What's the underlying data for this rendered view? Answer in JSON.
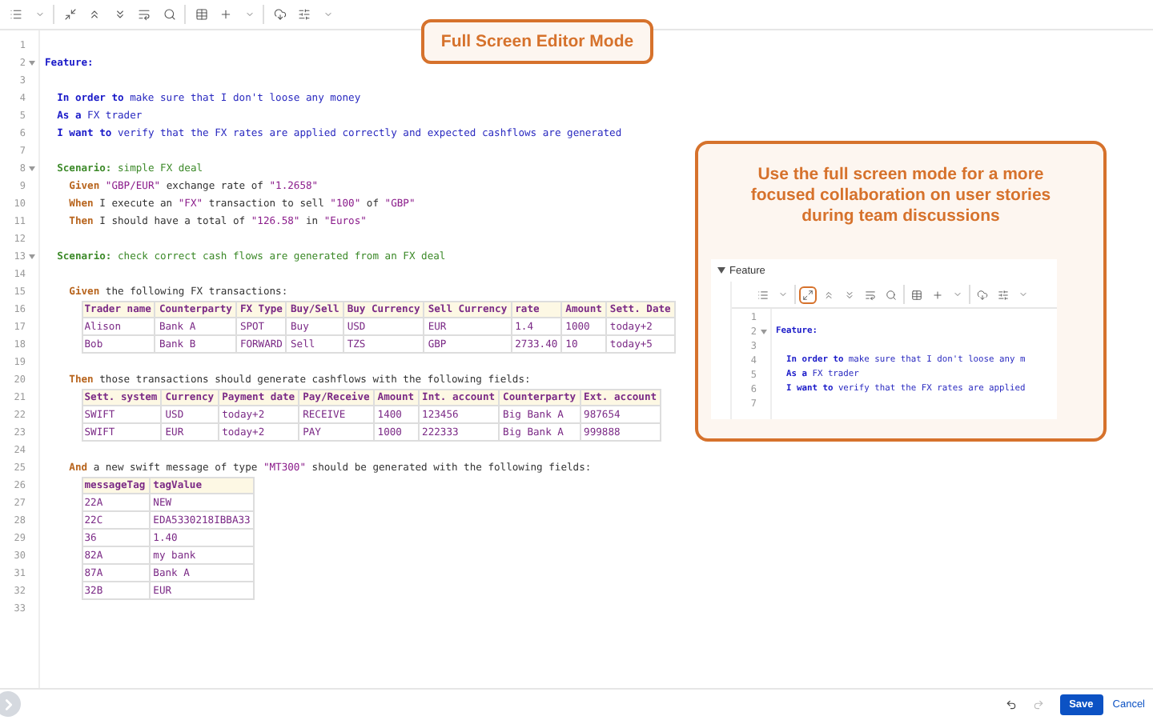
{
  "toolbar": [
    {
      "kind": "list"
    },
    {
      "kind": "caret"
    },
    {
      "kind": "separator"
    },
    {
      "kind": "shrink"
    },
    {
      "kind": "up"
    },
    {
      "kind": "down"
    },
    {
      "kind": "wrap"
    },
    {
      "kind": "search"
    },
    {
      "kind": "separator"
    },
    {
      "kind": "table"
    },
    {
      "kind": "plus"
    },
    {
      "kind": "caret"
    },
    {
      "kind": "separator"
    },
    {
      "kind": "cloud"
    },
    {
      "kind": "sliders"
    },
    {
      "kind": "caret"
    }
  ],
  "editor": {
    "lines": [
      {
        "number": "1",
        "kind": "blank",
        "fold": false
      },
      {
        "number": "2",
        "kind": "feature",
        "fold": true,
        "segments": [
          {
            "text": "Feature:",
            "kind": "keyword"
          }
        ]
      },
      {
        "number": "3",
        "kind": "blank",
        "fold": false
      },
      {
        "number": "4",
        "kind": "narrative",
        "fold": false,
        "segments": [
          {
            "text": "In order to",
            "kind": "keyword"
          },
          {
            "text": "make sure that I don't loose any money",
            "kind": "text"
          }
        ]
      },
      {
        "number": "5",
        "kind": "narrative",
        "fold": false,
        "segments": [
          {
            "text": "As a",
            "kind": "keyword"
          },
          {
            "text": "FX trader",
            "kind": "text"
          }
        ]
      },
      {
        "number": "6",
        "kind": "narrative",
        "fold": false,
        "segments": [
          {
            "text": "I want to",
            "kind": "keyword"
          },
          {
            "text": "verify that the FX rates are applied correctly and expected cashflows are generated",
            "kind": "text"
          }
        ]
      },
      {
        "number": "7",
        "kind": "blank",
        "fold": false
      },
      {
        "number": "8",
        "kind": "scenario",
        "fold": true,
        "segments": [
          {
            "text": "Scenario:",
            "kind": "keyword"
          },
          {
            "text": "simple FX deal",
            "kind": "text"
          }
        ]
      },
      {
        "number": "9",
        "kind": "step",
        "fold": false,
        "segments": [
          {
            "text": "Given",
            "kind": "keyword"
          },
          {
            "text": "\"GBP/EUR\"",
            "kind": "string"
          },
          {
            "text": "exchange rate of",
            "kind": "text"
          },
          {
            "text": "\"1.2658\"",
            "kind": "string"
          }
        ]
      },
      {
        "number": "10",
        "kind": "step",
        "fold": false,
        "segments": [
          {
            "text": "When",
            "kind": "keyword"
          },
          {
            "text": "I execute an",
            "kind": "text"
          },
          {
            "text": "\"FX\"",
            "kind": "string"
          },
          {
            "text": "transaction to sell",
            "kind": "text"
          },
          {
            "text": "\"100\"",
            "kind": "string"
          },
          {
            "text": "of",
            "kind": "text"
          },
          {
            "text": "\"GBP\"",
            "kind": "string"
          }
        ]
      },
      {
        "number": "11",
        "kind": "step",
        "fold": false,
        "segments": [
          {
            "text": "Then",
            "kind": "keyword"
          },
          {
            "text": "I should have a total of",
            "kind": "text"
          },
          {
            "text": "\"126.58\"",
            "kind": "string"
          },
          {
            "text": "in",
            "kind": "text"
          },
          {
            "text": "\"Euros\"",
            "kind": "string"
          }
        ]
      },
      {
        "number": "12",
        "kind": "blank",
        "fold": false
      },
      {
        "number": "13",
        "kind": "scenario",
        "fold": true,
        "segments": [
          {
            "text": "Scenario:",
            "kind": "keyword"
          },
          {
            "text": "check correct cash flows are generated from an FX deal",
            "kind": "text"
          }
        ]
      },
      {
        "number": "14",
        "kind": "blank",
        "fold": false
      },
      {
        "number": "15",
        "kind": "step",
        "fold": false,
        "segments": [
          {
            "text": "Given",
            "kind": "keyword"
          },
          {
            "text": "the following FX transactions:",
            "kind": "text"
          }
        ]
      },
      {
        "kind": "table",
        "rows": [
          {
            "number": "16",
            "header": true,
            "cells": [
              "Trader name",
              "Counterparty",
              "FX Type",
              "Buy/Sell",
              "Buy Currency",
              "Sell Currency",
              "rate",
              "Amount",
              "Sett. Date"
            ]
          },
          {
            "number": "17",
            "header": false,
            "cells": [
              "Alison",
              "Bank A",
              "SPOT",
              "Buy",
              "USD",
              "EUR",
              "1.4",
              "1000",
              "today+2"
            ]
          },
          {
            "number": "18",
            "header": false,
            "cells": [
              "Bob",
              "Bank B",
              "FORWARD",
              "Sell",
              "TZS",
              "GBP",
              "2733.40",
              "10",
              "today+5"
            ]
          }
        ]
      },
      {
        "number": "19",
        "kind": "blank",
        "fold": false
      },
      {
        "number": "20",
        "kind": "step",
        "fold": false,
        "segments": [
          {
            "text": "Then",
            "kind": "keyword"
          },
          {
            "text": "those transactions should generate cashflows with the following fields:",
            "kind": "text"
          }
        ]
      },
      {
        "kind": "table",
        "rows": [
          {
            "number": "21",
            "header": true,
            "cells": [
              "Sett. system",
              "Currency",
              "Payment date",
              "Pay/Receive",
              "Amount",
              "Int. account",
              "Counterparty",
              "Ext. account"
            ]
          },
          {
            "number": "22",
            "header": false,
            "cells": [
              "SWIFT",
              "USD",
              "today+2",
              "RECEIVE",
              "1400",
              "123456",
              "Big Bank A",
              "987654"
            ]
          },
          {
            "number": "23",
            "header": false,
            "cells": [
              "SWIFT",
              "EUR",
              "today+2",
              "PAY",
              "1000",
              "222333",
              "Big Bank A",
              "999888"
            ]
          }
        ]
      },
      {
        "number": "24",
        "kind": "blank",
        "fold": false
      },
      {
        "number": "25",
        "kind": "step",
        "fold": false,
        "segments": [
          {
            "text": "And",
            "kind": "keyword"
          },
          {
            "text": "a new swift message of type",
            "kind": "text"
          },
          {
            "text": "\"MT300\"",
            "kind": "string"
          },
          {
            "text": "should be generated with the following fields:",
            "kind": "text"
          }
        ]
      },
      {
        "kind": "table",
        "rows": [
          {
            "number": "26",
            "header": true,
            "cells": [
              "messageTag",
              "tagValue"
            ]
          },
          {
            "number": "27",
            "header": false,
            "cells": [
              "22A",
              "NEW"
            ]
          },
          {
            "number": "28",
            "header": false,
            "cells": [
              "22C",
              "EDA5330218IBBA33"
            ]
          },
          {
            "number": "29",
            "header": false,
            "cells": [
              "36",
              "1.40"
            ]
          },
          {
            "number": "30",
            "header": false,
            "cells": [
              "82A",
              "my bank"
            ]
          },
          {
            "number": "31",
            "header": false,
            "cells": [
              "87A",
              "Bank A"
            ]
          },
          {
            "number": "32",
            "header": false,
            "cells": [
              "32B",
              "EUR"
            ]
          }
        ]
      },
      {
        "number": "33",
        "kind": "blank",
        "fold": false
      }
    ]
  },
  "callout": {
    "title": "Full Screen Editor Mode"
  },
  "tip_card": {
    "text": "Use the full screen mode for a more focused collaboration on user stories during team discussions",
    "preview": {
      "section": "Feature",
      "expanded": true,
      "toolbar": [
        {
          "kind": "list"
        },
        {
          "kind": "caret"
        },
        {
          "kind": "separator"
        },
        {
          "kind": "expand",
          "highlighted": true
        },
        {
          "kind": "up"
        },
        {
          "kind": "down"
        },
        {
          "kind": "wrap"
        },
        {
          "kind": "search"
        },
        {
          "kind": "separator"
        },
        {
          "kind": "table"
        },
        {
          "kind": "plus"
        },
        {
          "kind": "caret"
        },
        {
          "kind": "separator"
        },
        {
          "kind": "cloud"
        },
        {
          "kind": "sliders"
        },
        {
          "kind": "caret"
        }
      ],
      "lines": [
        {
          "number": "1",
          "kind": "blank",
          "fold": false
        },
        {
          "number": "2",
          "kind": "feature",
          "fold": true,
          "segments": [
            {
              "text": "Feature:",
              "kind": "keyword"
            }
          ]
        },
        {
          "number": "3",
          "kind": "blank",
          "fold": false
        },
        {
          "number": "4",
          "kind": "narrative",
          "fold": false,
          "segments": [
            {
              "text": "In order to",
              "kind": "keyword"
            },
            {
              "text": "make sure that I don't loose any m",
              "kind": "text"
            }
          ]
        },
        {
          "number": "5",
          "kind": "narrative",
          "fold": false,
          "segments": [
            {
              "text": "As a",
              "kind": "keyword"
            },
            {
              "text": "FX trader",
              "kind": "text"
            }
          ]
        },
        {
          "number": "6",
          "kind": "narrative",
          "fold": false,
          "segments": [
            {
              "text": "I want to",
              "kind": "keyword"
            },
            {
              "text": "verify that the FX rates are applied",
              "kind": "text"
            }
          ]
        },
        {
          "number": "7",
          "kind": "blank",
          "fold": false
        }
      ]
    }
  },
  "footer": {
    "undo": {
      "disabled": false
    },
    "redo": {
      "disabled": true
    },
    "save": "Save",
    "cancel": "Cancel"
  }
}
